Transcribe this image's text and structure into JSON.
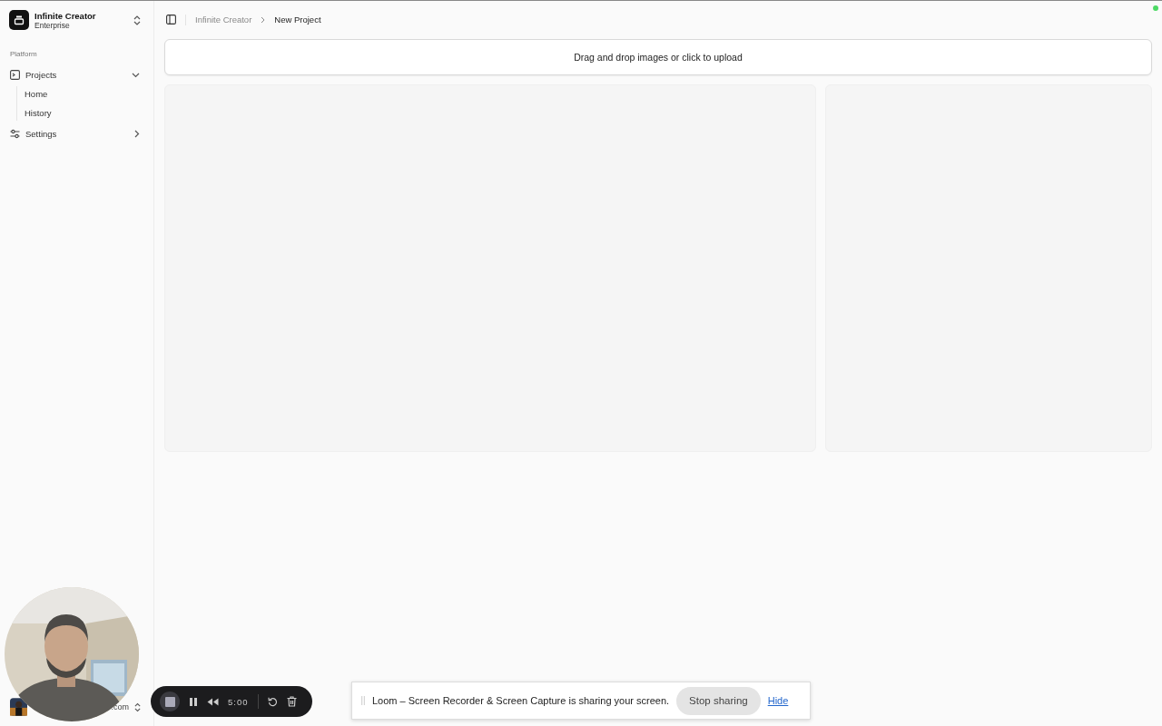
{
  "sidebar": {
    "team": {
      "name": "Infinite Creator",
      "plan": "Enterprise"
    },
    "group_label": "Platform",
    "items": [
      {
        "label": "Projects",
        "kind": "folder",
        "expanded": true,
        "children": [
          {
            "label": "Home"
          },
          {
            "label": "History"
          }
        ]
      },
      {
        "label": "Settings",
        "kind": "settings",
        "expanded": false
      }
    ],
    "user": {
      "email_fragment": ".com"
    }
  },
  "breadcrumb": [
    "Infinite Creator",
    "New Project"
  ],
  "upload": {
    "prompt": "Drag and drop images or click to upload"
  },
  "recorder": {
    "timer": "5:00"
  },
  "share_bar": {
    "message": "Loom – Screen Recorder & Screen Capture is sharing your screen.",
    "stop_label": "Stop sharing",
    "hide_label": "Hide"
  }
}
